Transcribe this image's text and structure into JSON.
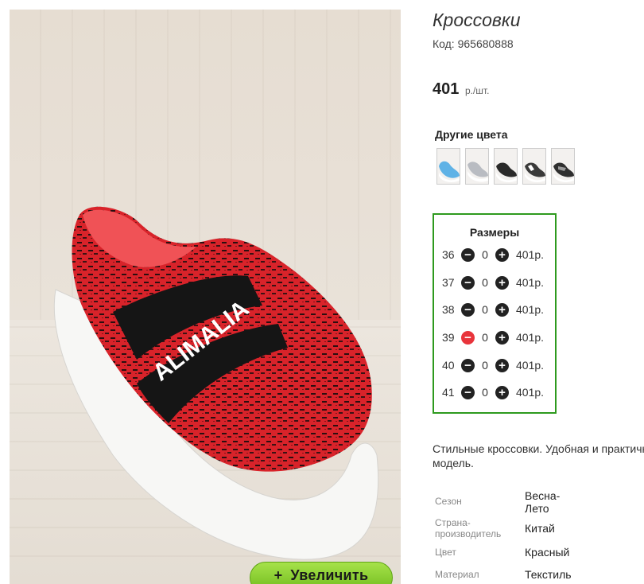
{
  "product": {
    "title": "Кроссовки",
    "code": "Код: 965680888",
    "price": "401",
    "price_unit": "р./шт."
  },
  "zoom_button": {
    "icon": "+",
    "label": "Увеличить"
  },
  "colors": {
    "label": "Другие цвета",
    "swatches": [
      {
        "name": "blue",
        "color": "#5fb2e6"
      },
      {
        "name": "grey",
        "color": "#b9bcc2"
      },
      {
        "name": "black",
        "color": "#2a2a2a"
      },
      {
        "name": "black-white",
        "color": "#3a3a3a"
      },
      {
        "name": "black-grey",
        "color": "#2f2f2f"
      }
    ]
  },
  "sizes": {
    "title": "Размеры",
    "rows": [
      {
        "size": "36",
        "qty": "0",
        "price": "401р."
      },
      {
        "size": "37",
        "qty": "0",
        "price": "401р."
      },
      {
        "size": "38",
        "qty": "0",
        "price": "401р."
      },
      {
        "size": "39",
        "qty": "0",
        "price": "401р."
      },
      {
        "size": "40",
        "qty": "0",
        "price": "401р."
      },
      {
        "size": "41",
        "qty": "0",
        "price": "401р."
      }
    ],
    "minus_symbol": "−",
    "plus_symbol": "+"
  },
  "description": "Стильные кроссовки. Удобная и практичная модель.",
  "attributes": [
    {
      "label": "Сезон",
      "value": "Весна-Лето"
    },
    {
      "label": "Страна-производитель",
      "value": "Китай"
    },
    {
      "label": "Цвет",
      "value": "Красный"
    },
    {
      "label": "Материал",
      "value": "Текстиль"
    }
  ],
  "photo": {
    "brand_text": "ALIMALIA"
  }
}
